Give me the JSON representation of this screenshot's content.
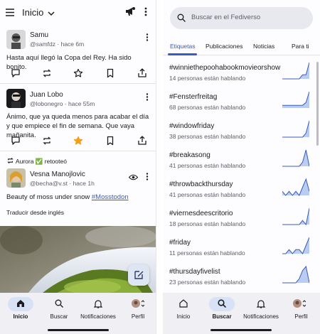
{
  "left": {
    "header": {
      "title": "Inicio"
    },
    "posts": [
      {
        "name": "Samu",
        "handle": "@samfdz",
        "time": "hace 6m",
        "text": "Hasta aquí llegó la Copa del Rey. Ha sido bonito.",
        "favorited": false
      },
      {
        "name": "Juan Lobo",
        "handle": "@lobonegro",
        "time": "hace 55m",
        "text": "Ánimo, que ya queda menos para acabar el día y que empiece el fin de semana. Que vaya mañanita.",
        "favorited": true
      }
    ],
    "boost": {
      "booster": "Aurora",
      "emoji": "✅",
      "suffix": "retooteó"
    },
    "boosted_post": {
      "name": "Vesna Manojlovic",
      "handle": "@becha@v.st",
      "time": "hace 1h",
      "text_prefix": "Beauty of moss under snow",
      "hashtag": "#Mosstodon",
      "translate": "Traducir desde inglés"
    },
    "nav": [
      {
        "label": "Inicio",
        "icon": "home-icon",
        "active": true
      },
      {
        "label": "Buscar",
        "icon": "search-icon",
        "active": false
      },
      {
        "label": "Notificaciones",
        "icon": "bell-icon",
        "active": false
      },
      {
        "label": "Perfil",
        "icon": "avatar-icon",
        "active": false
      }
    ]
  },
  "right": {
    "search": {
      "placeholder": "Buscar en el Fediverso"
    },
    "tabs": [
      {
        "label": "Etiquetas",
        "active": true
      },
      {
        "label": "Publicaciones",
        "active": false
      },
      {
        "label": "Noticias",
        "active": false
      },
      {
        "label": "Para ti",
        "active": false
      }
    ],
    "trends": [
      {
        "tag": "#winniethepoohabookmovieorshow",
        "count": "14 personas están hablando",
        "spark": [
          0,
          0,
          0,
          0,
          0,
          0,
          1,
          1,
          4
        ]
      },
      {
        "tag": "#Fensterfreitag",
        "count": "68 personas están hablando",
        "spark": [
          1,
          1,
          1,
          1,
          1,
          1,
          1,
          2,
          6
        ]
      },
      {
        "tag": "#windowfriday",
        "count": "38 personas están hablando",
        "spark": [
          0,
          0,
          0,
          0,
          0,
          0,
          0,
          1,
          4
        ]
      },
      {
        "tag": "#breakasong",
        "count": "41 personas están hablando",
        "spark": [
          0,
          0,
          0,
          0,
          0,
          0,
          1,
          4,
          0
        ]
      },
      {
        "tag": "#throwbackthursday",
        "count": "41 personas están hablando",
        "spark": [
          1,
          0,
          1,
          0,
          1,
          0,
          2,
          4,
          1
        ]
      },
      {
        "tag": "#viernesdeescritorio",
        "count": "18 personas están hablando",
        "spark": [
          0,
          0,
          0,
          0,
          0,
          0,
          1,
          0,
          4
        ]
      },
      {
        "tag": "#friday",
        "count": "11 personas están hablando",
        "spark": [
          0,
          0,
          1,
          0,
          1,
          1,
          0,
          2,
          4
        ]
      },
      {
        "tag": "#thursdayfivelist",
        "count": "23 personas están hablando",
        "spark": [
          0,
          0,
          0,
          0,
          0,
          1,
          3,
          4,
          0
        ]
      }
    ],
    "nav": [
      {
        "label": "Inicio",
        "icon": "home-icon",
        "active": false
      },
      {
        "label": "Buscar",
        "icon": "search-icon",
        "active": true
      },
      {
        "label": "Notificaciones",
        "icon": "bell-icon",
        "active": false
      },
      {
        "label": "Perfil",
        "icon": "avatar-icon",
        "active": false
      }
    ]
  },
  "colors": {
    "accent": "#3a5bbd",
    "star": "#f0a020",
    "pill": "#d8e2f6",
    "spark_fill": "#b8cdf0",
    "spark_line": "#3a5bbd"
  }
}
